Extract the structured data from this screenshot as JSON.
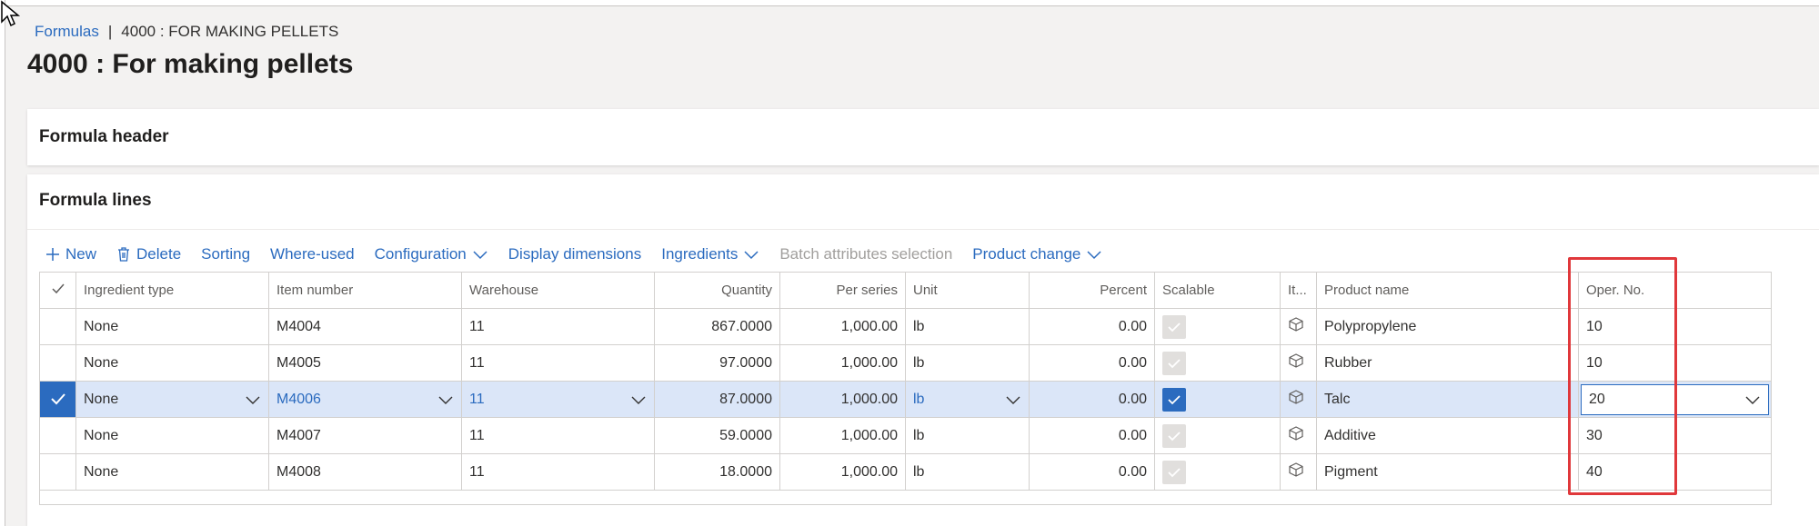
{
  "breadcrumb": {
    "parent": "Formulas",
    "separator": "|",
    "current": "4000 : FOR MAKING PELLETS"
  },
  "page_title": "4000 : For making pellets",
  "sections": {
    "header": "Formula header",
    "lines": "Formula lines"
  },
  "toolbar": {
    "new": "New",
    "delete": "Delete",
    "sorting": "Sorting",
    "where_used": "Where-used",
    "configuration": "Configuration",
    "display_dimensions": "Display dimensions",
    "ingredients": "Ingredients",
    "batch_attributes": "Batch attributes selection",
    "product_change": "Product change"
  },
  "columns": {
    "ingredient_type": "Ingredient type",
    "item_number": "Item number",
    "warehouse": "Warehouse",
    "quantity": "Quantity",
    "per_series": "Per series",
    "unit": "Unit",
    "percent": "Percent",
    "scalable": "Scalable",
    "it": "It...",
    "product_name": "Product name",
    "oper_no": "Oper. No."
  },
  "rows": [
    {
      "ingredient_type": "None",
      "item_number": "M4004",
      "warehouse": "11",
      "quantity": "867.0000",
      "per_series": "1,000.00",
      "unit": "lb",
      "percent": "0.00",
      "scalable": true,
      "product_name": "Polypropylene",
      "oper_no": "10"
    },
    {
      "ingredient_type": "None",
      "item_number": "M4005",
      "warehouse": "11",
      "quantity": "97.0000",
      "per_series": "1,000.00",
      "unit": "lb",
      "percent": "0.00",
      "scalable": true,
      "product_name": "Rubber",
      "oper_no": "10"
    },
    {
      "ingredient_type": "None",
      "item_number": "M4006",
      "warehouse": "11",
      "quantity": "87.0000",
      "per_series": "1,000.00",
      "unit": "lb",
      "percent": "0.00",
      "scalable": true,
      "product_name": "Talc",
      "oper_no": "20"
    },
    {
      "ingredient_type": "None",
      "item_number": "M4007",
      "warehouse": "11",
      "quantity": "59.0000",
      "per_series": "1,000.00",
      "unit": "lb",
      "percent": "0.00",
      "scalable": true,
      "product_name": "Additive",
      "oper_no": "30"
    },
    {
      "ingredient_type": "None",
      "item_number": "M4008",
      "warehouse": "11",
      "quantity": "18.0000",
      "per_series": "1,000.00",
      "unit": "lb",
      "percent": "0.00",
      "scalable": true,
      "product_name": "Pigment",
      "oper_no": "40"
    }
  ],
  "colors": {
    "accent": "#2b6bbf",
    "selected_row": "#dbe6f8",
    "highlight_box": "#e0383b"
  }
}
